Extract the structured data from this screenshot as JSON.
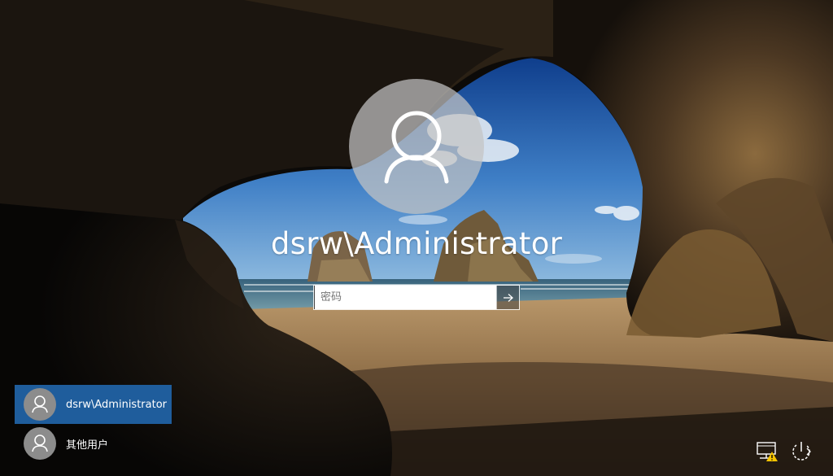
{
  "login": {
    "username": "dsrw\\Administrator",
    "password_placeholder": "密码",
    "password_value": ""
  },
  "user_list": [
    {
      "label": "dsrw\\Administrator",
      "selected": true,
      "icon": "user-icon"
    },
    {
      "label": "其他用户",
      "selected": false,
      "icon": "user-icon"
    }
  ],
  "icons": {
    "avatar": "user-silhouette-icon",
    "submit": "arrow-right-icon",
    "network": "network-warning-icon",
    "accessibility": "ease-of-access-icon",
    "power": "power-icon"
  },
  "colors": {
    "selected_user_bg": "#1f5d9c",
    "text": "#ffffff",
    "warning": "#f5c400"
  }
}
